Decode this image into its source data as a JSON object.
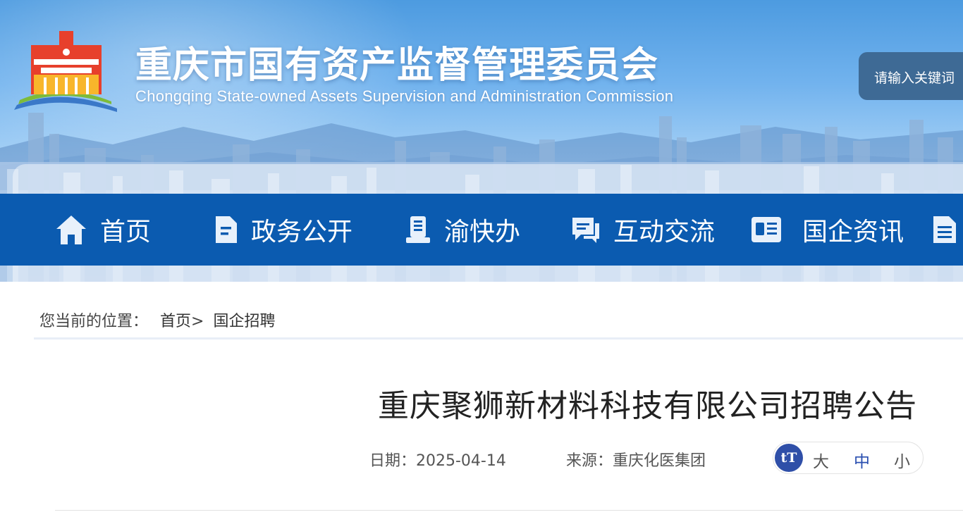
{
  "header": {
    "title": "重庆市国有资产监督管理委员会",
    "subtitle": "Chongqing State-owned Assets Supervision and Administration Commission",
    "logo_icon": "cq-sasac-logo",
    "search_placeholder": "请输入关键词"
  },
  "nav": {
    "items": [
      {
        "label": "首页",
        "icon": "home-icon"
      },
      {
        "label": "政务公开",
        "icon": "document-icon"
      },
      {
        "label": "渝快办",
        "icon": "service-icon"
      },
      {
        "label": "互动交流",
        "icon": "chat-icon"
      },
      {
        "label": "国企资讯",
        "icon": "news-icon"
      },
      {
        "label": "",
        "icon": "file-list-icon"
      }
    ],
    "color": "#0b5bb0"
  },
  "breadcrumb": {
    "prefix": "您当前的位置：",
    "home": "首页",
    "separator": ">",
    "current": "国企招聘"
  },
  "article": {
    "title": "重庆聚狮新材料科技有限公司招聘公告",
    "date": "日期：2025-04-14",
    "source": "来源：重庆化医集团"
  },
  "font_size": {
    "badge": "tT",
    "large": "大",
    "medium": "中",
    "small": "小"
  },
  "colors": {
    "accent": "#0b5bb0",
    "badge": "#2f4fa8",
    "search": "#3e6a95"
  }
}
